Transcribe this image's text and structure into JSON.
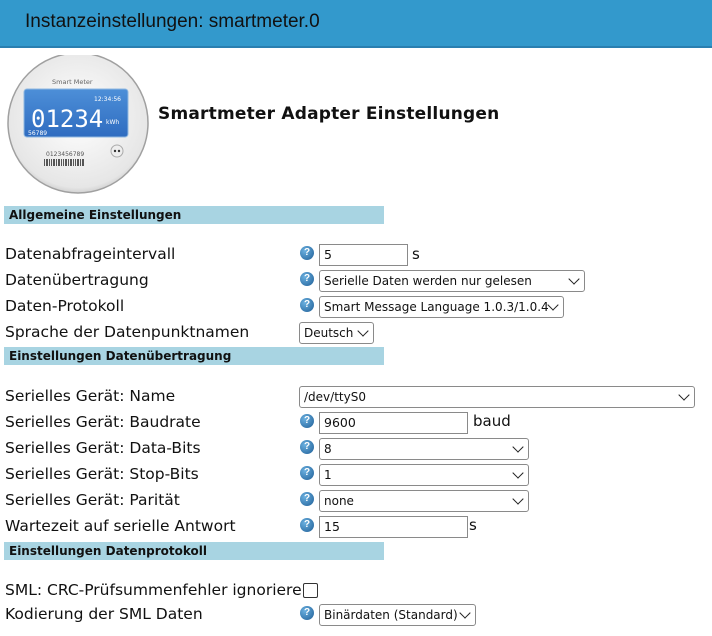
{
  "window": {
    "title": "Instanzeinstellungen: smartmeter.0"
  },
  "header": {
    "title": "Smartmeter Adapter Einstellungen",
    "logo": {
      "brand": "Smart Meter",
      "reading": "01234",
      "unit": "kWh",
      "time": "12:34:56",
      "small_number": "56789",
      "serial": "0123456789"
    }
  },
  "sections": {
    "general": "Allgemeine Einstellungen",
    "transmission": "Einstellungen Datenübertragung",
    "protocol": "Einstellungen Datenprotokoll"
  },
  "general": {
    "interval": {
      "label": "Datenabfrageintervall",
      "value": "5",
      "unit": "s"
    },
    "transfer": {
      "label": "Datenübertragung",
      "selected": "Serielle Daten werden nur gelesen"
    },
    "protocol": {
      "label": "Daten-Protokoll",
      "selected": "Smart Message Language 1.0.3/1.0.4"
    },
    "language": {
      "label": "Sprache der Datenpunktnamen",
      "selected": "Deutsch"
    }
  },
  "serial": {
    "name": {
      "label": "Serielles Gerät: Name",
      "selected": "/dev/ttyS0"
    },
    "baudrate": {
      "label": "Serielles Gerät: Baudrate",
      "value": "9600",
      "unit": "baud"
    },
    "databits": {
      "label": "Serielles Gerät: Data-Bits",
      "selected": "8"
    },
    "stopbits": {
      "label": "Serielles Gerät: Stop-Bits",
      "selected": "1"
    },
    "parity": {
      "label": "Serielles Gerät: Parität",
      "selected": "none"
    },
    "timeout": {
      "label": "Wartezeit auf serielle Antwort",
      "value": "15",
      "unit": "s"
    }
  },
  "sml": {
    "crc": {
      "label": "SML: CRC-Prüfsummenfehler ignorieren",
      "checked": false
    },
    "encoding": {
      "label": "Kodierung der SML Daten",
      "selected": "Binärdaten (Standard)"
    }
  },
  "help_glyph": "?",
  "colors": {
    "titlebar": "#3399cc",
    "section_header": "#a8d4e2",
    "help_icon": "#2a6fb0"
  }
}
